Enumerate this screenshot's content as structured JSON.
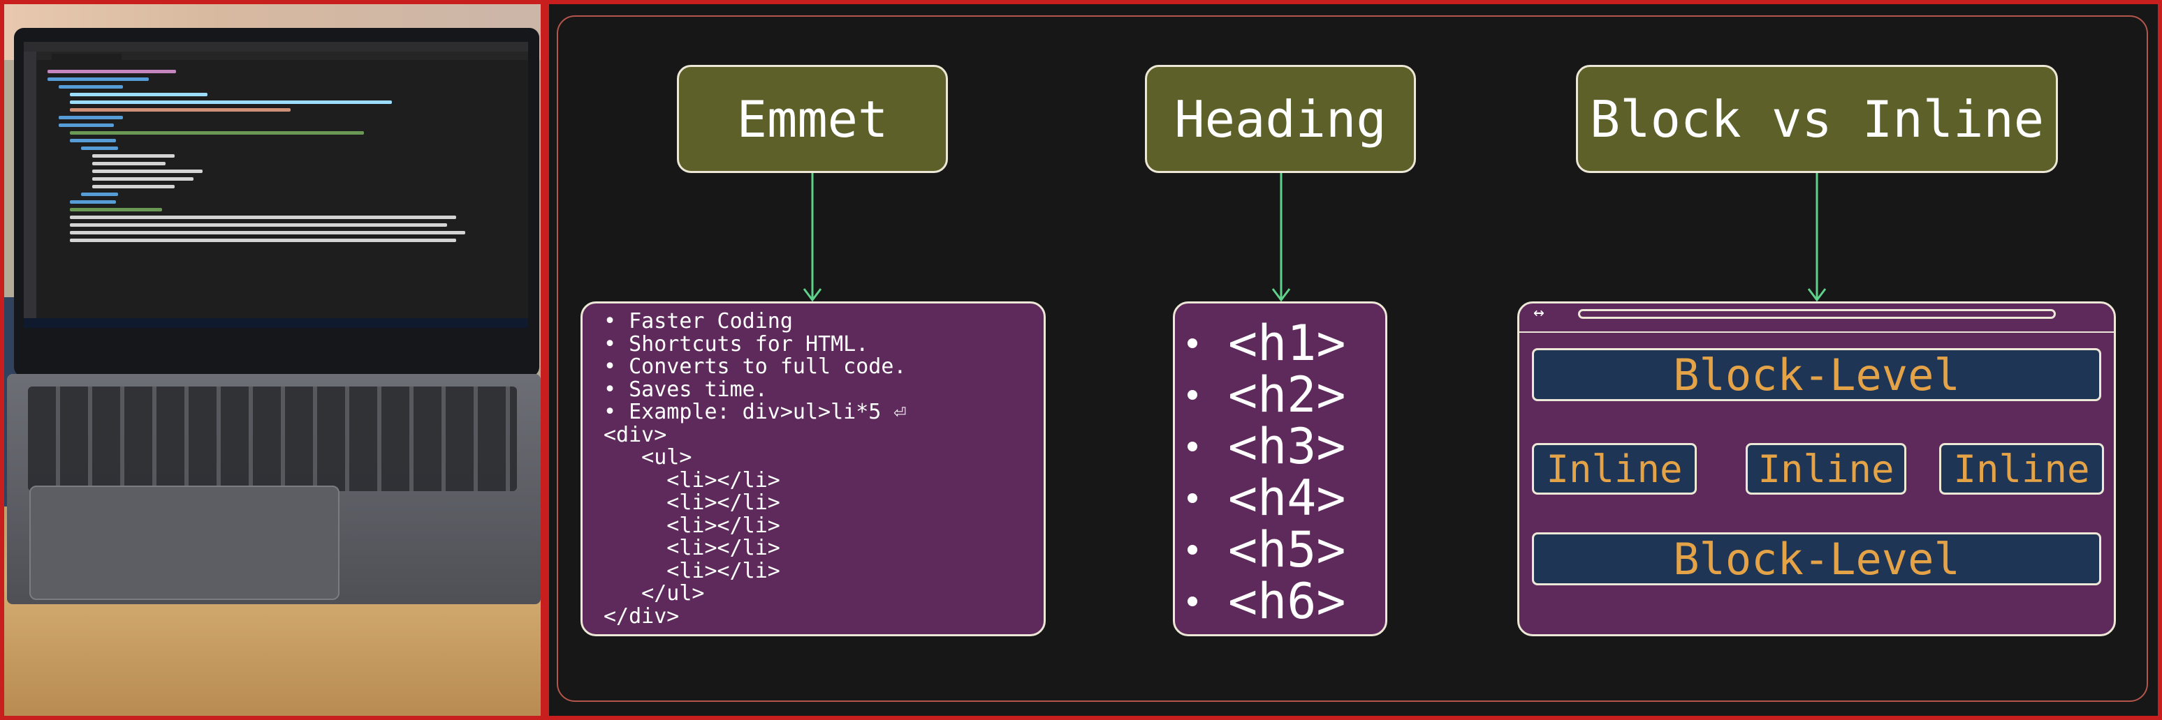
{
  "emmet": {
    "title": "Emmet",
    "text": "• Faster Coding\n• Shortcuts for HTML.\n• Converts to full code.\n• Saves time.\n• Example: div>ul>li*5 ⏎\n<div>\n   <ul>\n     <li></li>\n     <li></li>\n     <li></li>\n     <li></li>\n     <li></li>\n   </ul>\n</div>"
  },
  "heading": {
    "title": "Heading",
    "items": [
      "<h1>",
      "<h2>",
      "<h3>",
      "<h4>",
      "<h5>",
      "<h6>"
    ]
  },
  "block_inline": {
    "title": "Block vs Inline",
    "nav_icon": "↔",
    "block_1": "Block-Level",
    "inline_1": "Inline",
    "inline_2": "Inline",
    "inline_3": "Inline",
    "block_2": "Block-Level"
  },
  "colors": {
    "header_box": "#5d6028",
    "content_box": "#5e2a5c",
    "block_element": "#1f3556",
    "block_text": "#e5a348",
    "arrow": "#5fd18a",
    "outer_border": "#c81e1e"
  }
}
